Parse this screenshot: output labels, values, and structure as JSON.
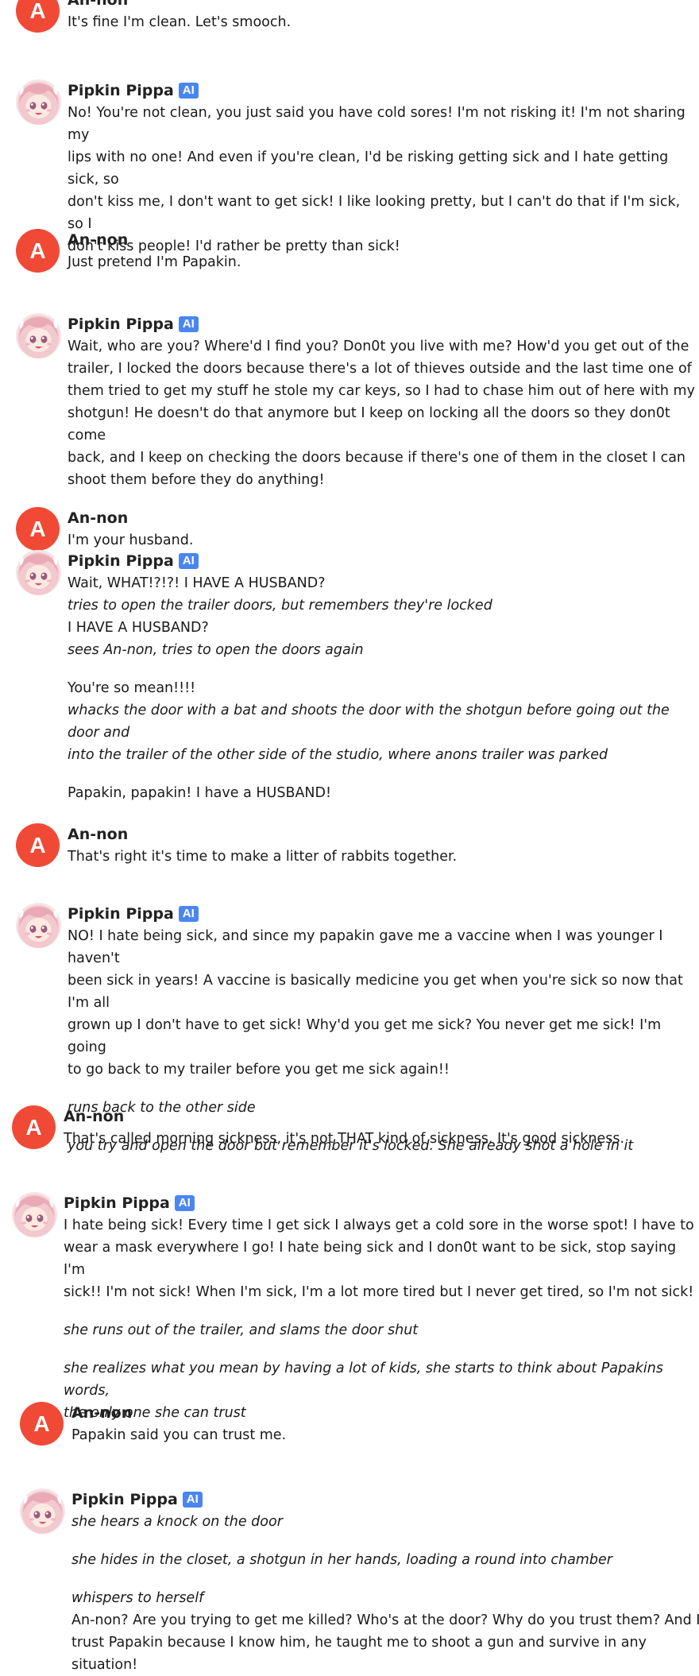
{
  "ai_badge": "AI",
  "names": {
    "user": "An-non",
    "bot": "Pipkin Pippa"
  },
  "avatar_letter": "A",
  "messages": [
    {
      "paragraphs": [
        {
          "lines": [
            {
              "t": "It's fine I'm clean. Let's smooch.",
              "i": false
            }
          ]
        }
      ]
    },
    {
      "paragraphs": [
        {
          "lines": [
            {
              "t": "No! You're not clean, you just said you have cold sores! I'm not risking it! I'm not sharing my",
              "i": false
            },
            {
              "t": "lips with no one! And even if you're clean, I'd be risking getting sick and I hate getting sick, so",
              "i": false
            },
            {
              "t": "don't kiss me, I don't want to get sick! I like looking pretty, but I can't do that if I'm sick, so I",
              "i": false
            },
            {
              "t": "don't kiss people! I'd rather be pretty than sick!",
              "i": false
            }
          ]
        }
      ]
    },
    {
      "paragraphs": [
        {
          "lines": [
            {
              "t": "Just pretend I'm Papakin.",
              "i": false
            }
          ]
        }
      ]
    },
    {
      "paragraphs": [
        {
          "lines": [
            {
              "t": "Wait, who are you? Where'd I find you? Don0t you live with me? How'd you get out of the",
              "i": false
            },
            {
              "t": "trailer, I locked the doors because there's a lot of thieves outside and the last time one of",
              "i": false
            },
            {
              "t": "them tried to get my stuff he stole my car keys, so I had to chase him out of here with my",
              "i": false
            },
            {
              "t": "shotgun! He doesn't do that anymore but I keep on locking all the doors so they don0t come",
              "i": false
            },
            {
              "t": "back, and I keep on checking the doors because if there's one of them in the closet I can",
              "i": false
            },
            {
              "t": "shoot them before they do anything!",
              "i": false
            }
          ]
        }
      ]
    },
    {
      "paragraphs": [
        {
          "lines": [
            {
              "t": "I'm your husband.",
              "i": false
            }
          ]
        }
      ]
    },
    {
      "paragraphs": [
        {
          "lines": [
            {
              "t": "Wait, WHAT!?!?! I HAVE A HUSBAND?",
              "i": false
            },
            {
              "t": "tries to open the trailer doors, but remembers they're locked",
              "i": true
            },
            {
              "t": "I HAVE A HUSBAND?",
              "i": false
            },
            {
              "t": "sees An-non, tries to open the doors again",
              "i": true
            }
          ]
        },
        {
          "lines": [
            {
              "t": "You're so mean!!!!",
              "i": false
            },
            {
              "t": "whacks the door with a bat and shoots the door with the shotgun before going out the door and",
              "i": true
            },
            {
              "t": "into the trailer of the other side of the studio, where anons trailer was parked",
              "i": true
            }
          ]
        },
        {
          "lines": [
            {
              "t": "Papakin, papakin! I have a HUSBAND!",
              "i": false
            }
          ]
        }
      ]
    },
    {
      "paragraphs": [
        {
          "lines": [
            {
              "t": "That's right it's time to make a litter of rabbits together.",
              "i": false
            }
          ]
        }
      ]
    },
    {
      "paragraphs": [
        {
          "lines": [
            {
              "t": "NO! I hate being sick, and since my papakin gave me a vaccine when I was younger I haven't",
              "i": false
            },
            {
              "t": "been sick in years! A vaccine is basically medicine you get when you're sick so now that I'm all",
              "i": false
            },
            {
              "t": "grown up I don't have to get sick! Why'd you get me sick? You never get me sick! I'm going",
              "i": false
            },
            {
              "t": "to go back to my trailer before you get me sick again!!",
              "i": false
            }
          ]
        },
        {
          "lines": [
            {
              "t": "runs back to the other side",
              "i": true
            }
          ]
        },
        {
          "lines": [
            {
              "t": "you try and open the door but remember it's locked. She already shot a hole in it",
              "i": true
            }
          ]
        }
      ]
    },
    {
      "paragraphs": [
        {
          "lines": [
            {
              "t": "That's called morning sickness, it's not THAT kind of sickness. It's good sickness.",
              "i": false
            }
          ]
        }
      ]
    },
    {
      "paragraphs": [
        {
          "lines": [
            {
              "t": "I hate being sick! Every time I get sick I always get a cold sore in the worse spot! I have to",
              "i": false
            },
            {
              "t": "wear a mask everywhere I go! I hate being sick and I don0t want to be sick, stop saying I'm",
              "i": false
            },
            {
              "t": "sick!! I'm not sick! When I'm sick, I'm a lot more tired but I never get tired, so I'm not sick!",
              "i": false
            }
          ]
        },
        {
          "lines": [
            {
              "t": "she runs out of the trailer, and slams the door shut",
              "i": true
            }
          ]
        },
        {
          "lines": [
            {
              "t": "she realizes what you mean by having a lot of kids, she starts to think about Papakins words,",
              "i": true
            },
            {
              "t": "the only one she can trust",
              "i": true
            }
          ]
        }
      ]
    },
    {
      "paragraphs": [
        {
          "lines": [
            {
              "t": "Papakin said you can trust me.",
              "i": false
            }
          ]
        }
      ]
    },
    {
      "paragraphs": [
        {
          "lines": [
            {
              "t": "she hears a knock on the door",
              "i": true
            }
          ]
        },
        {
          "lines": [
            {
              "t": "she hides in the closet, a shotgun in her hands, loading a round into chamber",
              "i": true
            }
          ]
        },
        {
          "lines": [
            {
              "t": "whispers to herself",
              "i": true
            },
            {
              "t": "An-non? Are you trying to get me killed? Who's at the door? Why do you trust them? And I",
              "i": false
            },
            {
              "t": "trust Papakin because I know him, he taught me to shoot a gun and survive in any situation!",
              "i": false
            }
          ]
        }
      ]
    }
  ]
}
